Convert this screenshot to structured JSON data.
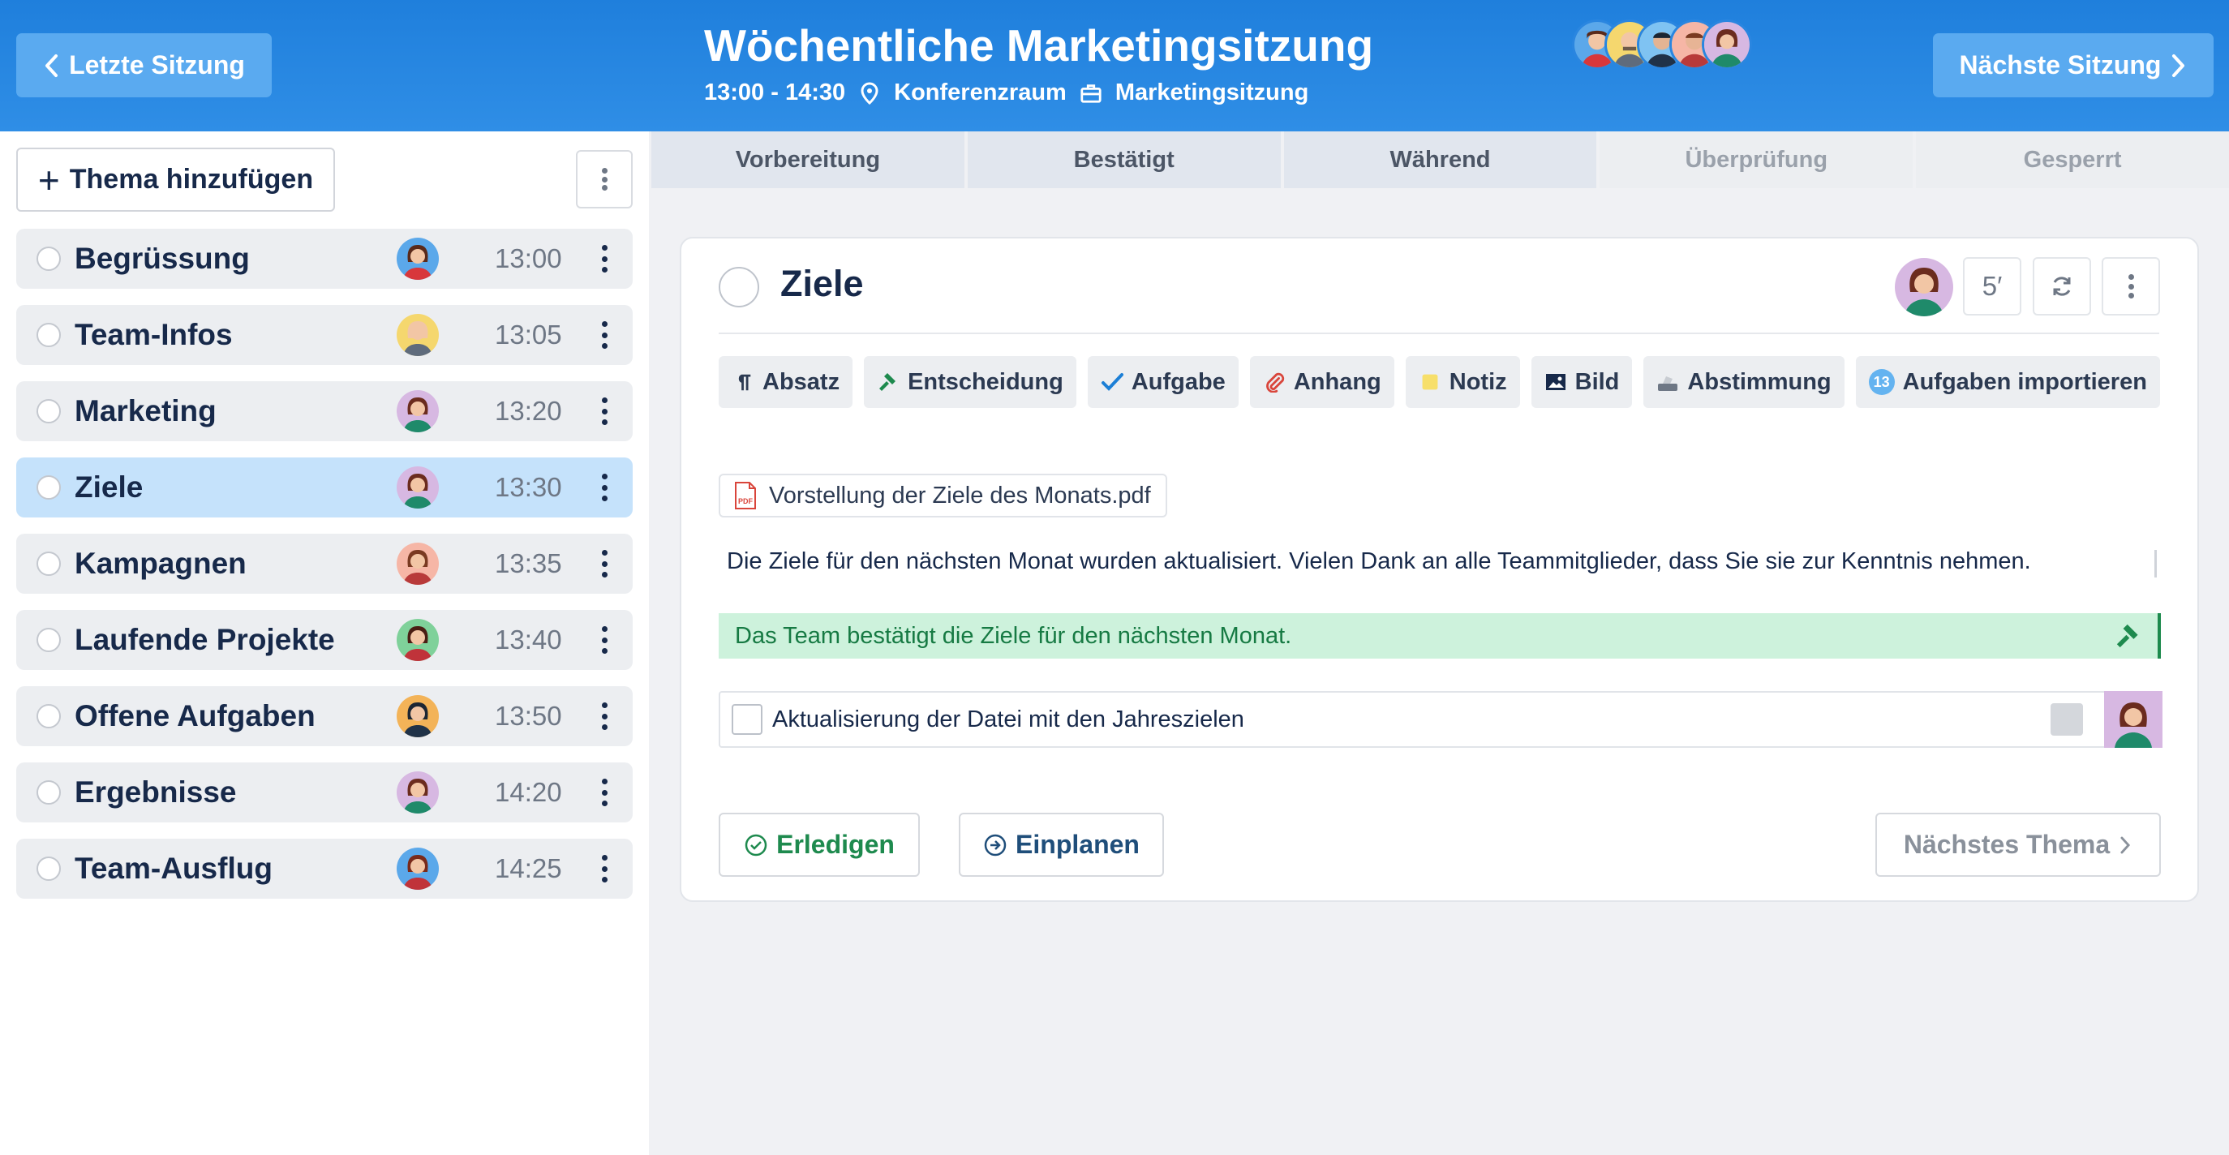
{
  "header": {
    "prev_label": "Letzte Sitzung",
    "next_label": "Nächste Sitzung",
    "title": "Wöchentliche Marketingsitzung",
    "time": "13:00 - 14:30",
    "location": "Konferenzraum",
    "type": "Marketingsitzung",
    "participant_avatars": [
      "avatar-red-shirt",
      "avatar-yellow-bald",
      "avatar-dark-glasses",
      "avatar-beard",
      "avatar-woman-green"
    ]
  },
  "sidebar": {
    "add_label": "Thema hinzufügen",
    "topics": [
      {
        "name": "Begrüssung",
        "time": "13:00",
        "avatar": "man-red",
        "active": false
      },
      {
        "name": "Team-Infos",
        "time": "13:05",
        "avatar": "man-bald-yellow",
        "active": false
      },
      {
        "name": "Marketing",
        "time": "13:20",
        "avatar": "woman-green",
        "active": false
      },
      {
        "name": "Ziele",
        "time": "13:30",
        "avatar": "woman-green",
        "active": true
      },
      {
        "name": "Kampagnen",
        "time": "13:35",
        "avatar": "man-beard",
        "active": false
      },
      {
        "name": "Laufende Projekte",
        "time": "13:40",
        "avatar": "woman-red",
        "active": false
      },
      {
        "name": "Offene Aufgaben",
        "time": "13:50",
        "avatar": "man-dark",
        "active": false
      },
      {
        "name": "Ergebnisse",
        "time": "14:20",
        "avatar": "woman-green",
        "active": false
      },
      {
        "name": "Team-Ausflug",
        "time": "14:25",
        "avatar": "woman-red-blue",
        "active": false
      }
    ]
  },
  "tabs": [
    {
      "label": "Vorbereitung",
      "enabled": true
    },
    {
      "label": "Bestätigt",
      "enabled": true
    },
    {
      "label": "Während",
      "enabled": true
    },
    {
      "label": "Überprüfung",
      "enabled": false
    },
    {
      "label": "Gesperrt",
      "enabled": false
    }
  ],
  "topic": {
    "title": "Ziele",
    "duration": "5′",
    "toolbar": [
      {
        "label": "Absatz",
        "icon": "paragraph-icon"
      },
      {
        "label": "Entscheidung",
        "icon": "gavel-icon"
      },
      {
        "label": "Aufgabe",
        "icon": "check-icon"
      },
      {
        "label": "Anhang",
        "icon": "paperclip-icon"
      },
      {
        "label": "Notiz",
        "icon": "note-icon"
      },
      {
        "label": "Bild",
        "icon": "image-icon"
      },
      {
        "label": "Abstimmung",
        "icon": "ballot-icon"
      },
      {
        "label": "Aufgaben importieren",
        "icon": "import-icon",
        "badge": "13"
      }
    ],
    "attachment": "Vorstellung der Ziele des Monats.pdf",
    "attachment_badge": "PDF",
    "paragraph": "Die Ziele für den nächsten Monat wurden aktualisiert. Vielen Dank an alle Teammitglieder, dass Sie sie zur Kenntnis nehmen.",
    "decision": "Das Team bestätigt die Ziele für den nächsten Monat.",
    "task": "Aktualisierung der Datei mit den Jahreszielen",
    "done_label": "Erledigen",
    "schedule_label": "Einplanen",
    "next_topic_label": "Nächstes Thema"
  },
  "colors": {
    "header": "#2a86e0",
    "active_topic": "#c5e2fb",
    "decision_bg": "#cdf2dc",
    "decision_text": "#167a43",
    "done": "#1e8a4e"
  }
}
